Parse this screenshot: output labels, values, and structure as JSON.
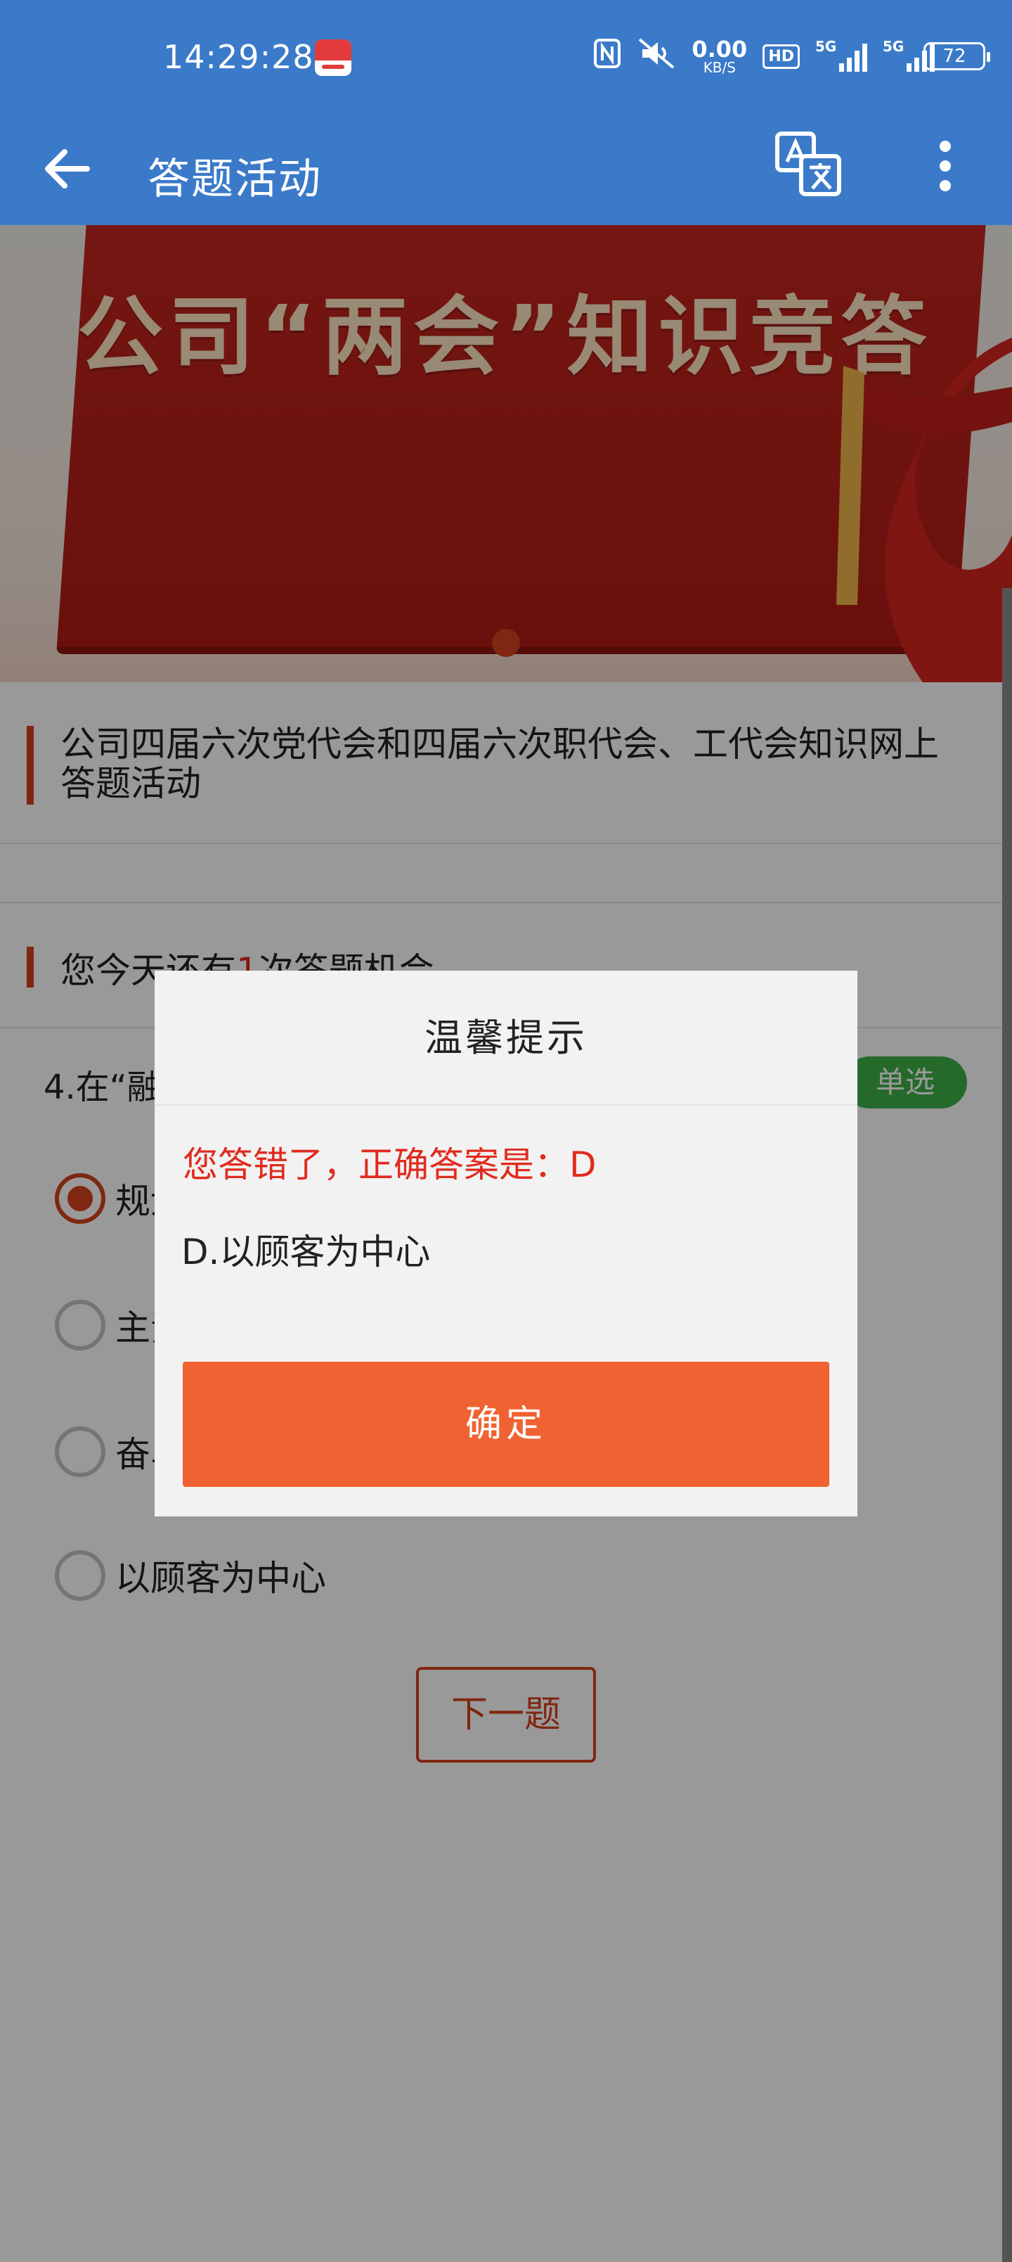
{
  "status_bar": {
    "time": "14:29:28",
    "network_speed": "0.00",
    "network_unit": "KB/S",
    "hd_label": "HD",
    "signal_1_label": "5G",
    "signal_2_label": "5G",
    "battery": "72"
  },
  "app_bar": {
    "title": "答题活动",
    "background_color": "#3a7ac9"
  },
  "banner": {
    "title": "公司“两会”知识竞答"
  },
  "activity": {
    "title": "公司四届六次党代会和四届六次职代会、工代会知识网上答题活动",
    "chances_prefix": "您今天还有",
    "chances_count": "1",
    "chances_suffix": "次答题机会"
  },
  "question": {
    "text": "4.在“融入大循环”中践行（ ）。",
    "type": "单选",
    "options": [
      {
        "label": "规划引领",
        "selected": true
      },
      {
        "label": "主责主业",
        "selected": false
      },
      {
        "label": "奋斗者精神",
        "selected": false
      },
      {
        "label": "以顾客为中心",
        "selected": false
      }
    ],
    "next_button": "下一题"
  },
  "dialog": {
    "title": "温馨提示",
    "message": "您答错了，正确答案是：D",
    "answer": "D.以顾客为中心",
    "confirm_button": "确定"
  },
  "colors": {
    "accent": "#d4421c",
    "tag_green": "#3eb049",
    "confirm_orange": "#f06231",
    "error_red": "#e12b1f"
  }
}
